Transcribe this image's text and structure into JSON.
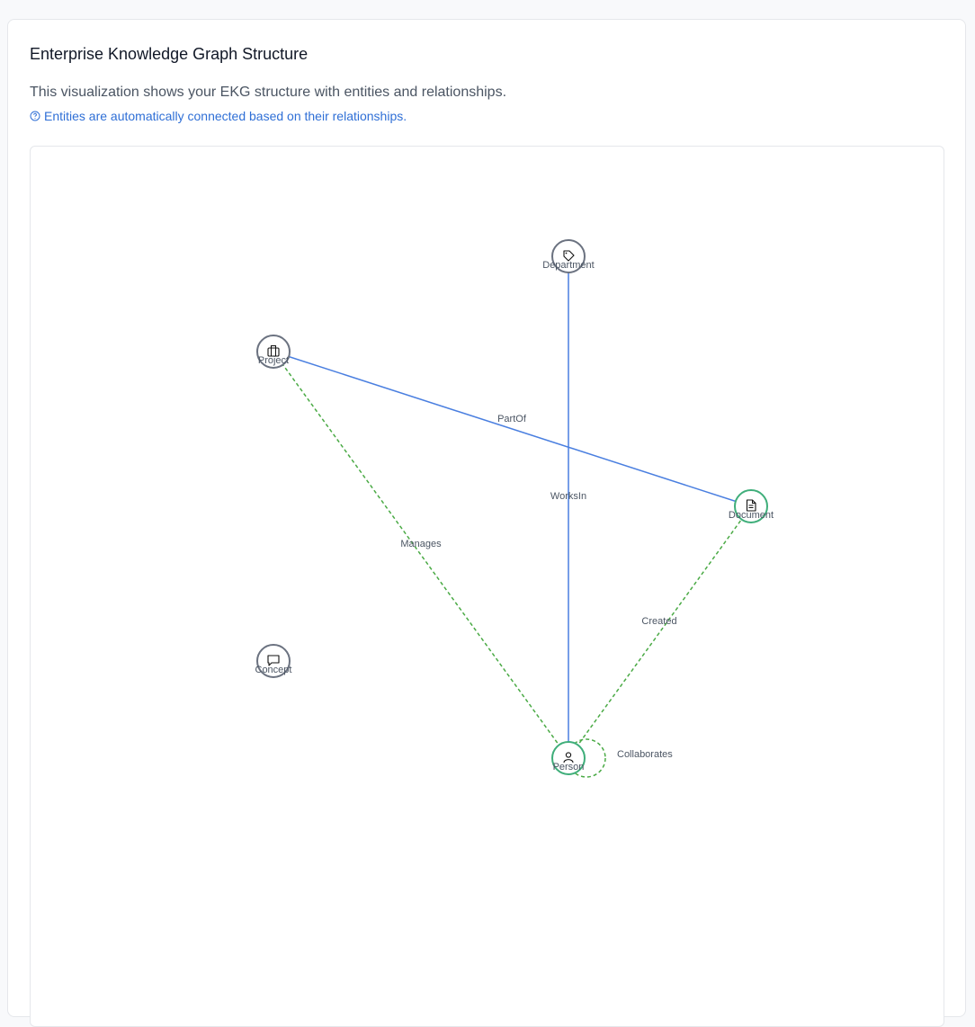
{
  "card": {
    "title": "Enterprise Knowledge Graph Structure",
    "description": "This visualization shows your EKG structure with entities and relationships.",
    "hint": "Entities are automatically connected based on their relationships.",
    "hint_icon": "help-circle-icon"
  },
  "colors": {
    "accent_blue": "#4a7fe0",
    "accent_green": "#4aaa45",
    "node_gray": "#6b7280",
    "node_green": "#3fae7a"
  },
  "graph": {
    "nodes": [
      {
        "id": "department",
        "label": "Department",
        "icon": "tag-icon",
        "status": "gray"
      },
      {
        "id": "project",
        "label": "Project",
        "icon": "briefcase-icon",
        "status": "gray"
      },
      {
        "id": "document",
        "label": "Document",
        "icon": "file-text-icon",
        "status": "green"
      },
      {
        "id": "concept",
        "label": "Concept",
        "icon": "message-square-icon",
        "status": "gray"
      },
      {
        "id": "person",
        "label": "Person",
        "icon": "user-icon",
        "status": "green"
      }
    ],
    "edges": [
      {
        "id": "worksin",
        "label": "WorksIn",
        "from": "person",
        "to": "department",
        "style": "solid"
      },
      {
        "id": "partof",
        "label": "PartOf",
        "from": "document",
        "to": "project",
        "style": "solid"
      },
      {
        "id": "manages",
        "label": "Manages",
        "from": "person",
        "to": "project",
        "style": "dashed"
      },
      {
        "id": "created",
        "label": "Created",
        "from": "person",
        "to": "document",
        "style": "dashed"
      },
      {
        "id": "collaborates",
        "label": "Collaborates",
        "from": "person",
        "to": "person",
        "style": "dashed"
      }
    ]
  }
}
